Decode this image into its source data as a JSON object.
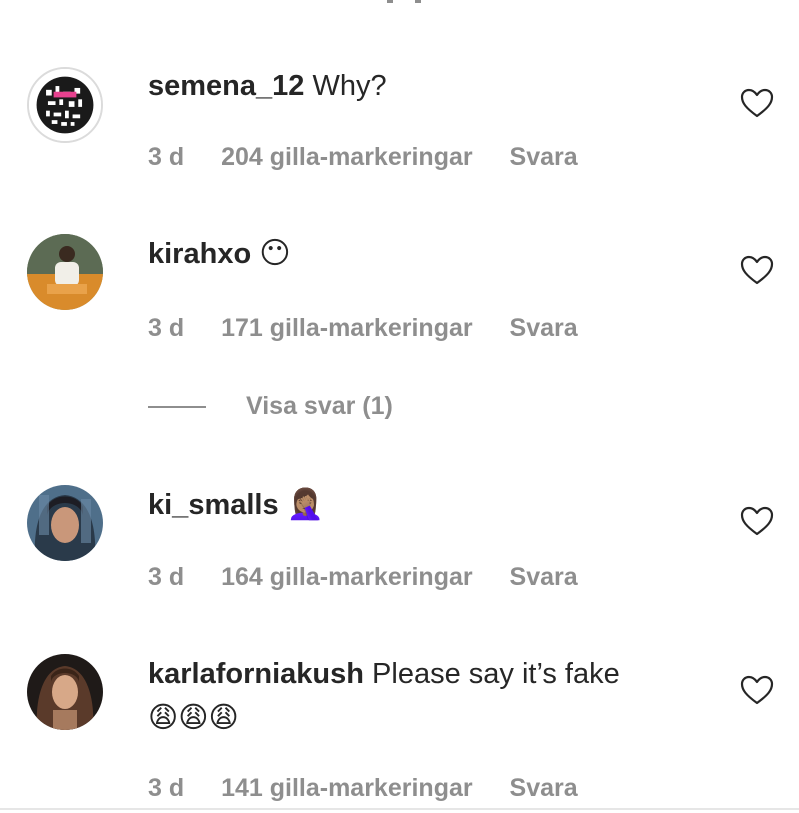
{
  "comments": [
    {
      "username": "semena_12",
      "text": "Why?",
      "time": "3 d",
      "likes": "204 gilla-markeringar",
      "reply": "Svara",
      "avatar": "qr-code-avatar"
    },
    {
      "username": "kirahxo",
      "text": "😶",
      "time": "3 d",
      "likes": "171 gilla-markeringar",
      "reply": "Svara",
      "avatar": "photo-avatar"
    },
    {
      "username": "ki_smalls",
      "text": "🤦🏽‍♀️",
      "time": "3 d",
      "likes": "164 gilla-markeringar",
      "reply": "Svara",
      "avatar": "photo-avatar"
    },
    {
      "username": "karlaforniakush",
      "text": "Please say it’s fake 😩😩😩",
      "time": "3 d",
      "likes": "141 gilla-markeringar",
      "reply": "Svara",
      "avatar": "photo-avatar"
    }
  ],
  "view_replies": "Visa svar (1)",
  "icons": {
    "like": "heart-outline-icon"
  },
  "colors": {
    "text": "#262626",
    "secondary": "#8e8e8e"
  }
}
